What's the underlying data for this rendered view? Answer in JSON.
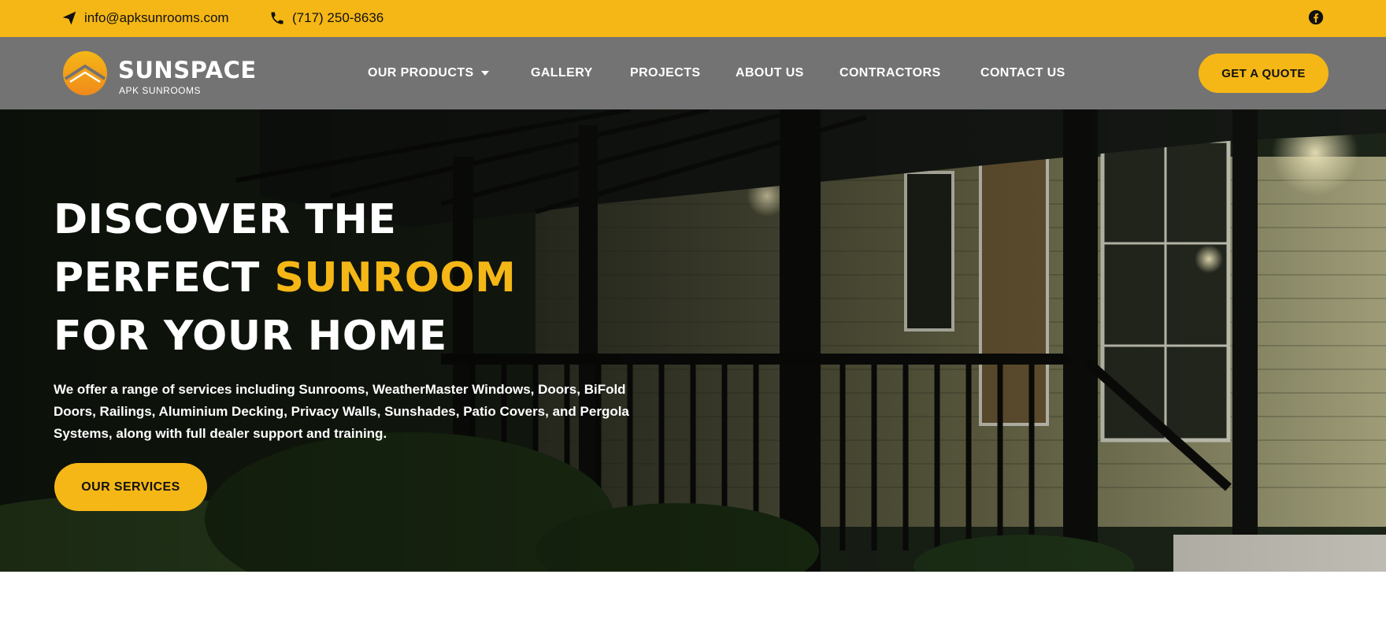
{
  "topbar": {
    "email": "info@apksunrooms.com",
    "phone": "(717) 250-8636",
    "icons": {
      "email": "paper-plane-icon",
      "phone": "phone-icon",
      "social": "facebook-icon"
    }
  },
  "brand": {
    "name": "SUNSPACE",
    "subtitle": "APK SUNROOMS"
  },
  "nav": {
    "items": [
      {
        "label": "OUR PRODUCTS",
        "has_dropdown": true
      },
      {
        "label": "GALLERY"
      },
      {
        "label": "PROJECTS"
      },
      {
        "label": "ABOUT US"
      },
      {
        "label": "CONTRACTORS"
      },
      {
        "label": "CONTACT US"
      }
    ],
    "cta": "GET A QUOTE"
  },
  "hero": {
    "line1": "DISCOVER THE",
    "line2": "PERFECT",
    "line2_accent": "SUNROOM",
    "line3": "FOR YOUR HOME",
    "description": "We offer a range of services including Sunrooms, WeatherMaster Windows, Doors, BiFold Doors, Railings, Aluminium Decking, Privacy Walls, Sunshades, Patio Covers, and Pergola Systems, along with full dealer support and training.",
    "button": "OUR SERVICES"
  },
  "colors": {
    "accent": "#f5b716",
    "header_bg": "#737373",
    "text_light": "#ffffff",
    "text_dark": "#111111"
  }
}
